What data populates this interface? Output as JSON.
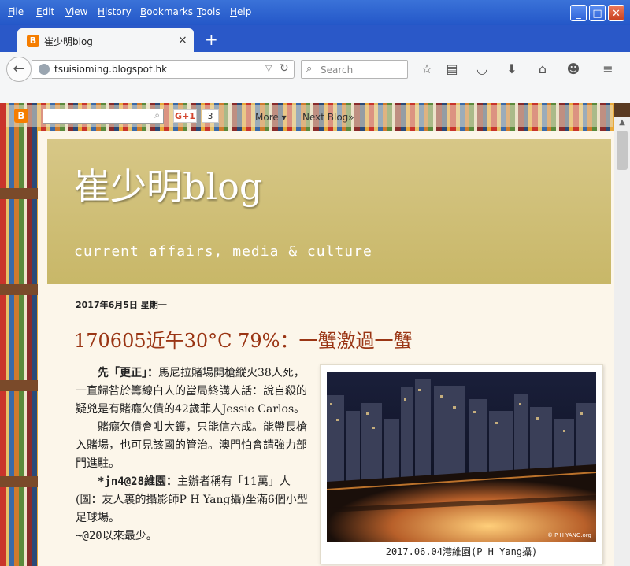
{
  "browser": {
    "menu": [
      "File",
      "Edit",
      "View",
      "History",
      "Bookmarks",
      "Tools",
      "Help"
    ],
    "tab": {
      "title": "崔少明blog",
      "close": "×"
    },
    "new_tab": "+",
    "url": "tsuisioming.blogspot.hk",
    "search_placeholder": "Search",
    "window_buttons": {
      "minimize": "_",
      "maximize": "□",
      "close": "✕"
    }
  },
  "blogger_bar": {
    "gplus": "G+1",
    "gplus_count": "3",
    "more": "More ▾",
    "next_blog": "Next Blog»"
  },
  "blog": {
    "title": "崔少明blog",
    "description": "current affairs, media & culture"
  },
  "post": {
    "date": "2017年6月5日 星期一",
    "title": "170605近午30°C 79%：一蟹激過一蟹",
    "paragraphs": [
      {
        "lead": "先「更正」：",
        "text": "馬尼拉賭場開槍縱火38人死，一直歸咎於籌線白人的當局終講人話：說自殺的疑兇是有賭癮欠債的42歲菲人Jessie Carlos。"
      },
      {
        "lead": "",
        "text": "賭癮欠債會咁大鑊，只能信六成。能帶長槍入賭場，也可見該國的管治。澳門怕會請強力部門進駐。"
      },
      {
        "lead": "*jn4@28維園：",
        "text": "主辦者稱有「11萬」人(圖：友人裏的攝影師P H Yang攝)坐滿6個小型足球場。"
      },
      {
        "lead": "",
        "text": "~@20以來最少。"
      }
    ],
    "figure": {
      "watermark": "© P H YANG.org",
      "caption": "2017.06.04港維園(P H Yang攝)"
    }
  }
}
